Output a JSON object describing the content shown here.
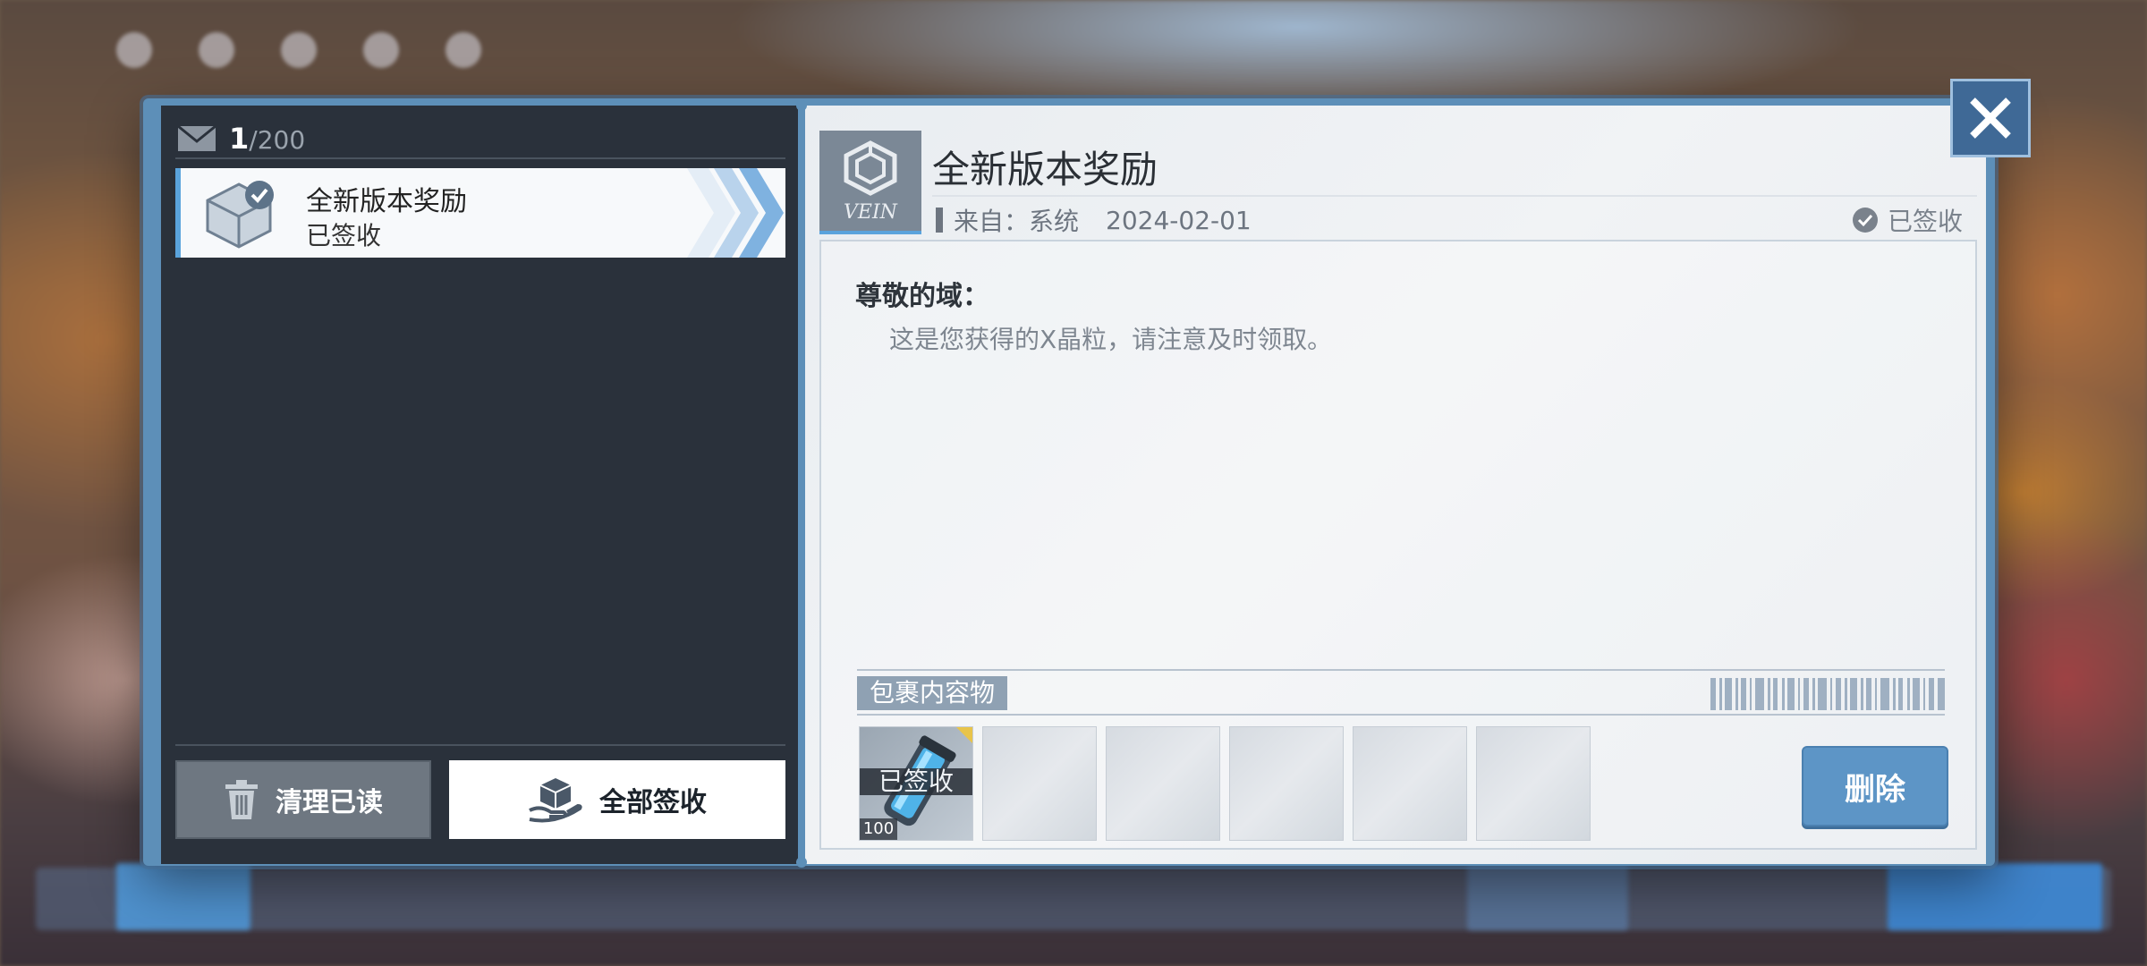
{
  "mail_list": {
    "current_count": "1",
    "separator": "/",
    "max_count": "200",
    "items": [
      {
        "title": "全新版本奖励",
        "status": "已签收"
      }
    ],
    "clear_read_label": "清理已读",
    "claim_all_label": "全部签收"
  },
  "mail_detail": {
    "sender_logo_text": "VEIN",
    "title": "全新版本奖励",
    "from_label": "来自：系统",
    "date": "2024-02-01",
    "status": "已签收",
    "greeting": "尊敬的域：",
    "body": "这是您获得的X晶粒，请注意及时领取。",
    "package_label": "包裹内容物",
    "attachments": [
      {
        "overlay": "已签收",
        "quantity": "100"
      }
    ],
    "delete_label": "删除"
  },
  "icons": {
    "close": "close-icon",
    "mail": "envelope-icon",
    "trash": "trash-icon",
    "claim_all": "box-hand-icon",
    "claimed_check": "check-circle-icon"
  },
  "colors": {
    "accent": "#5aa3dc",
    "frame": "#5d8fb8",
    "left_panel": "#2a313b",
    "delete_button": "#5d95c6"
  }
}
